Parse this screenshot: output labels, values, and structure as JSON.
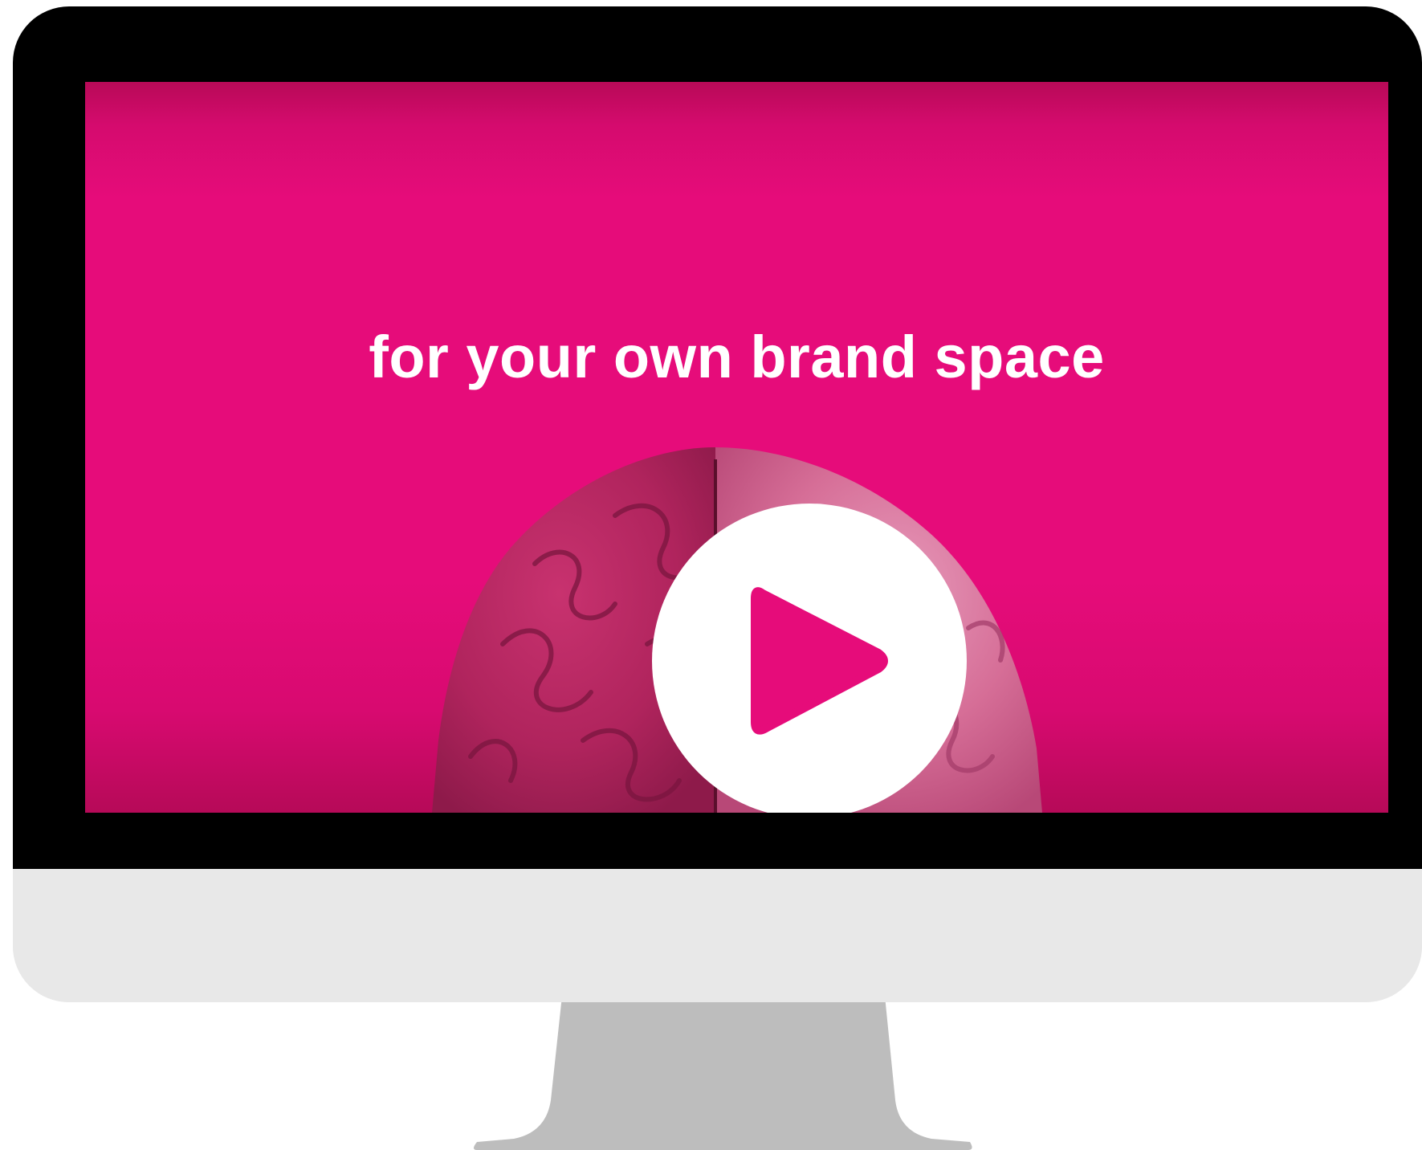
{
  "video": {
    "title": "for your own brand space",
    "play_icon": "play-icon",
    "brand_color": "#e60c7a"
  },
  "device": {
    "frame_color": "#000000",
    "chin_color": "#e8e8e8",
    "stand_color": "#bdbdbd"
  }
}
